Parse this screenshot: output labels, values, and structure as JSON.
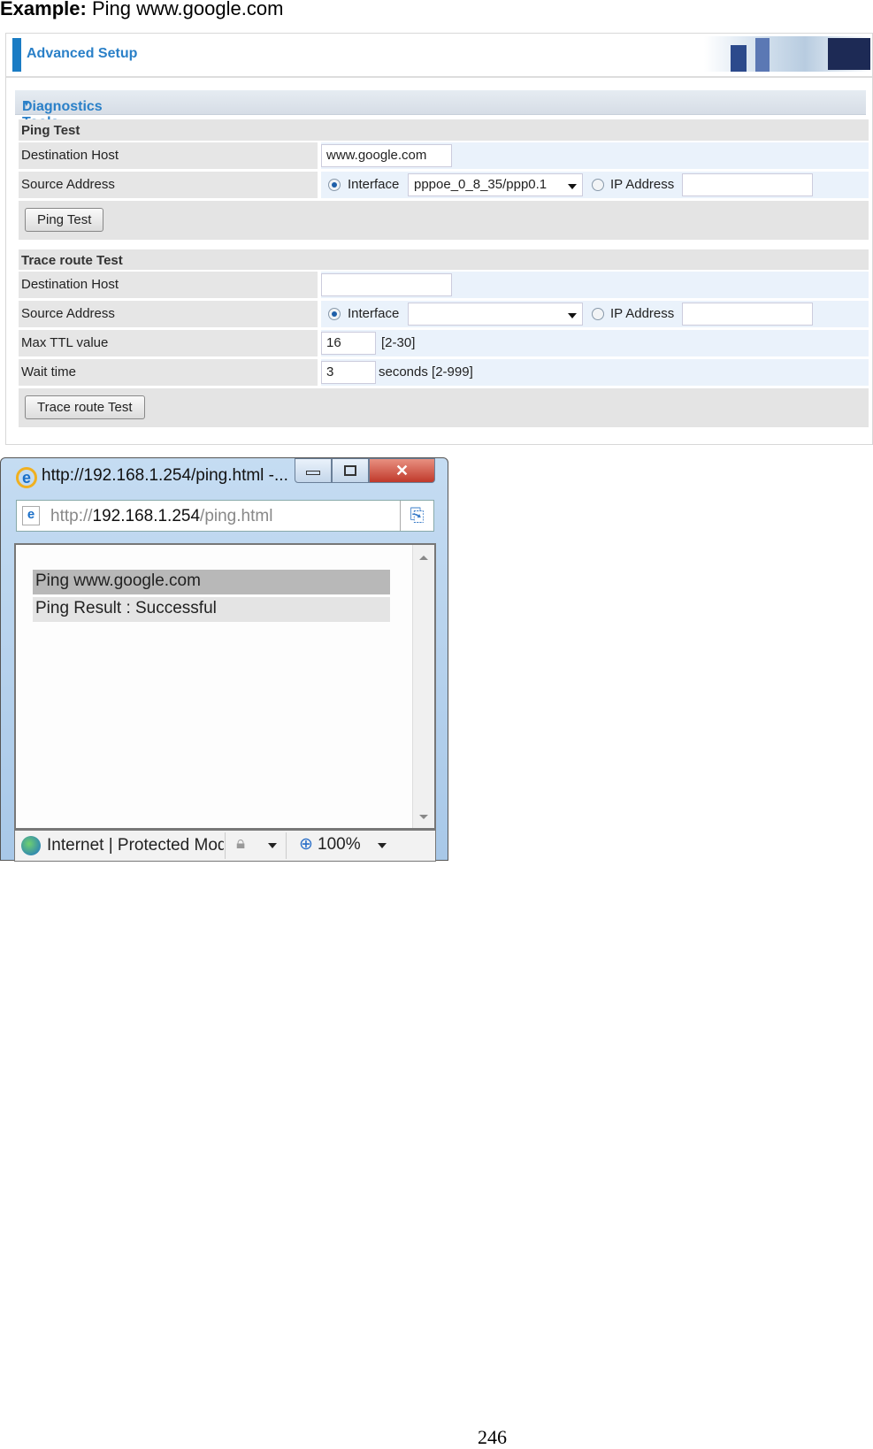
{
  "example": {
    "label": "Example:",
    "text": "Ping www.google.com"
  },
  "header": {
    "title": "Advanced Setup"
  },
  "section_title": "Diagnostics Tools",
  "ping": {
    "title": "Ping Test",
    "dest_label": "Destination Host",
    "dest_value": "www.google.com",
    "source_label": "Source Address",
    "interface_label": "Interface",
    "interface_value": "pppoe_0_8_35/ppp0.1",
    "ip_label": "IP Address",
    "ip_value": "",
    "selected_source": "Interface",
    "button": "Ping Test"
  },
  "trace": {
    "title": "Trace route Test",
    "dest_label": "Destination Host",
    "dest_value": "",
    "source_label": "Source Address",
    "interface_label": "Interface",
    "interface_value": "",
    "ip_label": "IP Address",
    "ip_value": "",
    "selected_source": "Interface",
    "ttl_label": "Max TTL value",
    "ttl_value": "16",
    "ttl_hint": "[2-30]",
    "wait_label": "Wait time",
    "wait_value": "3",
    "wait_hint": "seconds [2-999]",
    "button": "Trace route Test"
  },
  "browser": {
    "title": "http://192.168.1.254/ping.html -...",
    "url_prefix": "http://",
    "url_host": "192.168.1.254",
    "url_path": "/ping.html",
    "result_header": "Ping www.google.com",
    "result": "Ping Result : Successful",
    "status_zone": "Internet | Protected Mode",
    "zoom": "100%"
  },
  "page_number": "246"
}
